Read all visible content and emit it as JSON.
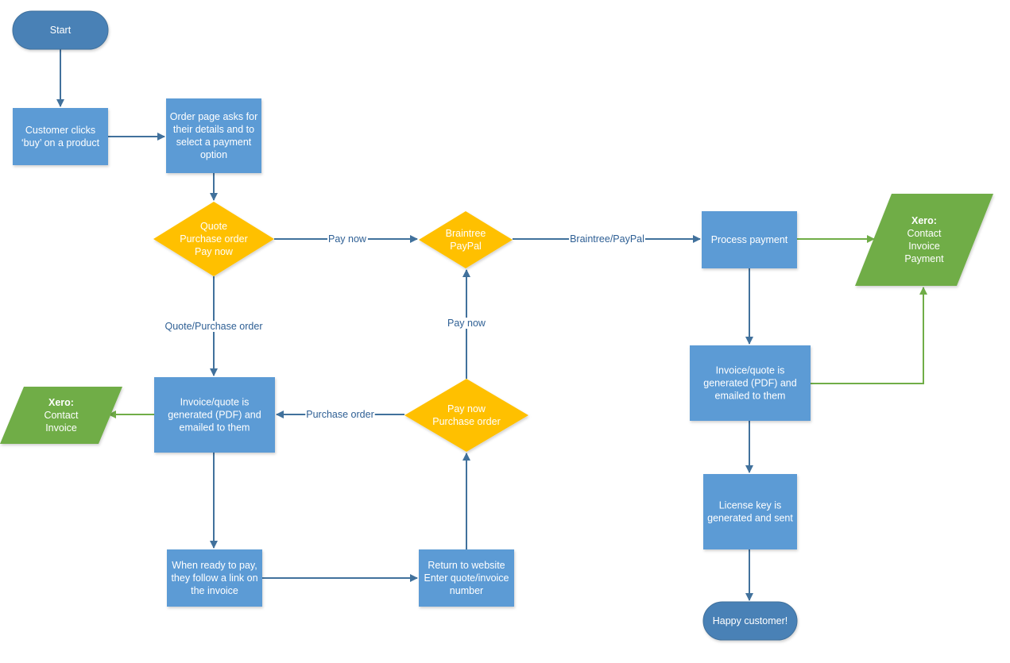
{
  "colors": {
    "process": "#5b9bd5",
    "terminal": "#4a81b6",
    "decision": "#ffc000",
    "data": "#70ad47",
    "edge_blue": "#41719c",
    "edge_green": "#70ad47",
    "label": "#2e5f94"
  },
  "nodes": {
    "start": {
      "type": "terminal",
      "lines": [
        "Start"
      ]
    },
    "customer_clicks": {
      "type": "process",
      "lines": [
        "Customer clicks",
        "‘buy’ on a product"
      ]
    },
    "order_page": {
      "type": "process",
      "lines": [
        "Order page asks for",
        "their details and to",
        "select a payment",
        "option"
      ]
    },
    "decision_payment": {
      "type": "decision",
      "lines": [
        "Quote",
        "Purchase order",
        "Pay now"
      ]
    },
    "decision_gateway": {
      "type": "decision",
      "lines": [
        "Braintree",
        "PayPal"
      ]
    },
    "process_payment": {
      "type": "process",
      "lines": [
        "Process payment"
      ]
    },
    "xero_right": {
      "type": "data",
      "bold_line": "Xero:",
      "lines": [
        "Contact",
        "Invoice",
        "Payment"
      ]
    },
    "invoice_left": {
      "type": "process",
      "lines": [
        "Invoice/quote is",
        "generated (PDF) and",
        "emailed to them"
      ]
    },
    "xero_left": {
      "type": "data",
      "bold_line": "Xero:",
      "lines": [
        "Contact",
        "Invoice"
      ]
    },
    "decision_return": {
      "type": "decision",
      "lines": [
        "Pay now",
        "Purchase order"
      ]
    },
    "ready_to_pay": {
      "type": "process",
      "lines": [
        "When ready to pay,",
        "they follow a link on",
        "the invoice"
      ]
    },
    "return_website": {
      "type": "process",
      "lines": [
        "Return to website",
        "Enter quote/invoice",
        "number"
      ]
    },
    "invoice_right": {
      "type": "process",
      "lines": [
        "Invoice/quote is",
        "generated (PDF) and",
        "emailed to them"
      ]
    },
    "license_key": {
      "type": "process",
      "lines": [
        "License key is",
        "generated and sent"
      ]
    },
    "happy_customer": {
      "type": "terminal",
      "lines": [
        "Happy customer!"
      ]
    }
  },
  "edges": [
    {
      "from": "start",
      "to": "customer_clicks",
      "label": ""
    },
    {
      "from": "customer_clicks",
      "to": "order_page",
      "label": ""
    },
    {
      "from": "order_page",
      "to": "decision_payment",
      "label": ""
    },
    {
      "from": "decision_payment",
      "to": "decision_gateway",
      "label": "Pay now"
    },
    {
      "from": "decision_payment",
      "to": "invoice_left",
      "label": "Quote/Purchase order"
    },
    {
      "from": "decision_gateway",
      "to": "process_payment",
      "label": "Braintree/PayPal"
    },
    {
      "from": "process_payment",
      "to": "xero_right",
      "label": ""
    },
    {
      "from": "process_payment",
      "to": "invoice_right",
      "label": ""
    },
    {
      "from": "invoice_right",
      "to": "xero_right",
      "label": ""
    },
    {
      "from": "invoice_right",
      "to": "license_key",
      "label": ""
    },
    {
      "from": "license_key",
      "to": "happy_customer",
      "label": ""
    },
    {
      "from": "invoice_left",
      "to": "xero_left",
      "label": ""
    },
    {
      "from": "invoice_left",
      "to": "ready_to_pay",
      "label": ""
    },
    {
      "from": "ready_to_pay",
      "to": "return_website",
      "label": ""
    },
    {
      "from": "return_website",
      "to": "decision_return",
      "label": ""
    },
    {
      "from": "decision_return",
      "to": "decision_gateway",
      "label": "Pay now"
    },
    {
      "from": "decision_return",
      "to": "invoice_left",
      "label": "Purchase order"
    }
  ]
}
